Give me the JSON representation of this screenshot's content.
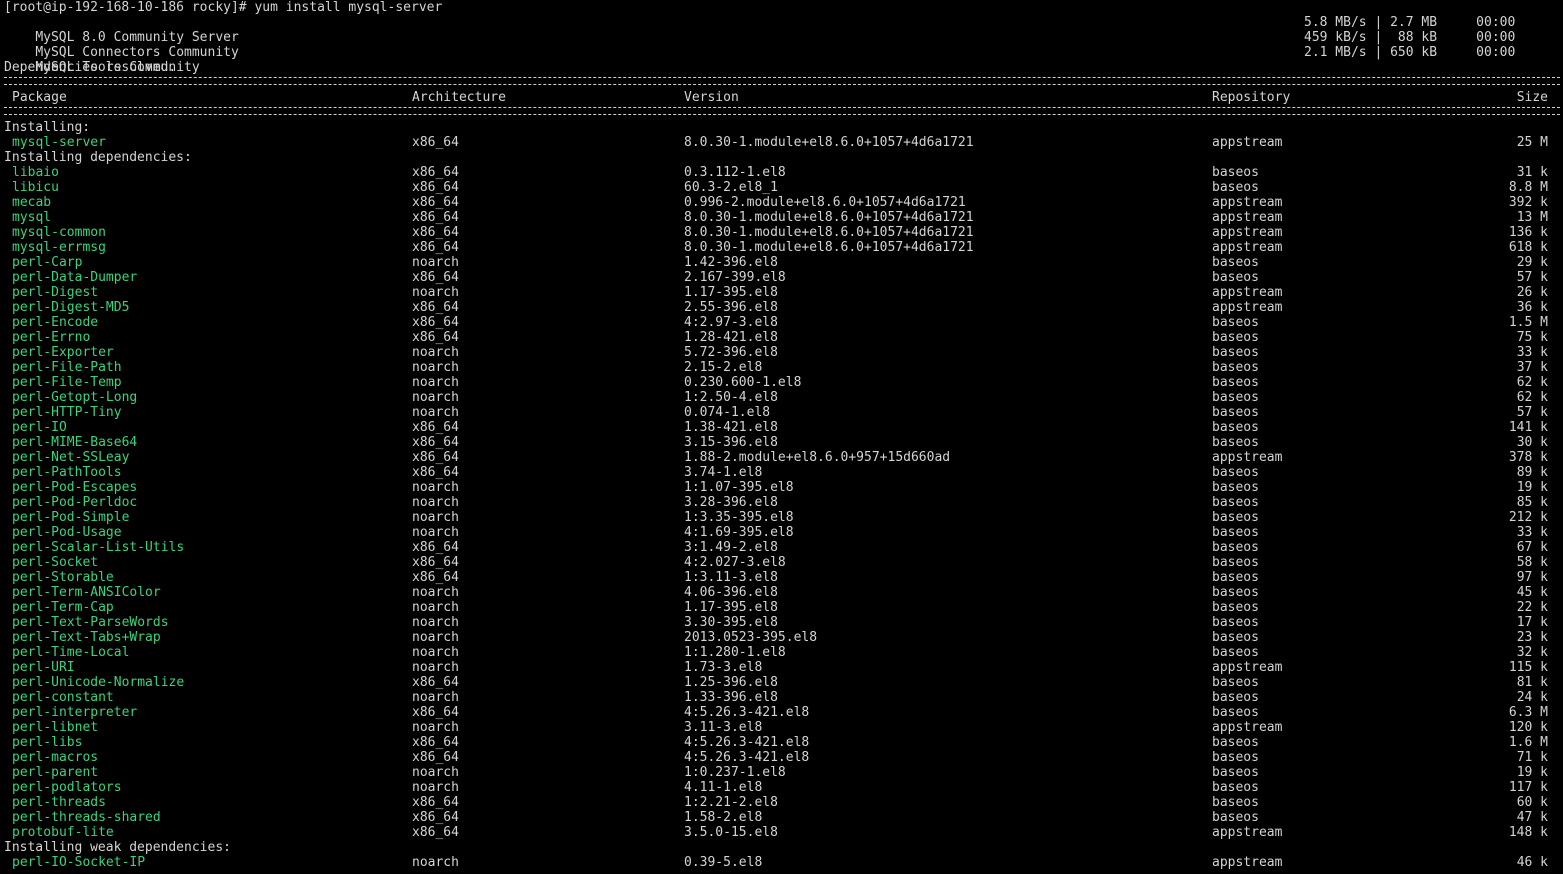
{
  "prompt_line": "[root@ip-192-168-10-186 rocky]# yum install mysql-server",
  "repo_downloads": [
    {
      "name": "MySQL 8.0 Community Server",
      "stats": "5.8 MB/s | 2.7 MB     00:00"
    },
    {
      "name": "MySQL Connectors Community",
      "stats": "459 kB/s |  88 kB     00:00"
    },
    {
      "name": "MySQL Tools Community",
      "stats": "2.1 MB/s | 650 kB     00:00"
    }
  ],
  "deps_resolved": "Dependencies resolved.",
  "headers": {
    "package": "Package",
    "arch": "Architecture",
    "version": "Version",
    "repo": "Repository",
    "size": "Size"
  },
  "sections": [
    {
      "title": "Installing:",
      "rows": [
        {
          "name": "mysql-server",
          "arch": "x86_64",
          "version": "8.0.30-1.module+el8.6.0+1057+4d6a1721",
          "repo": "appstream",
          "size": "25 M"
        }
      ]
    },
    {
      "title": "Installing dependencies:",
      "rows": [
        {
          "name": "libaio",
          "arch": "x86_64",
          "version": "0.3.112-1.el8",
          "repo": "baseos",
          "size": "31 k"
        },
        {
          "name": "libicu",
          "arch": "x86_64",
          "version": "60.3-2.el8_1",
          "repo": "baseos",
          "size": "8.8 M"
        },
        {
          "name": "mecab",
          "arch": "x86_64",
          "version": "0.996-2.module+el8.6.0+1057+4d6a1721",
          "repo": "appstream",
          "size": "392 k"
        },
        {
          "name": "mysql",
          "arch": "x86_64",
          "version": "8.0.30-1.module+el8.6.0+1057+4d6a1721",
          "repo": "appstream",
          "size": "13 M"
        },
        {
          "name": "mysql-common",
          "arch": "x86_64",
          "version": "8.0.30-1.module+el8.6.0+1057+4d6a1721",
          "repo": "appstream",
          "size": "136 k"
        },
        {
          "name": "mysql-errmsg",
          "arch": "x86_64",
          "version": "8.0.30-1.module+el8.6.0+1057+4d6a1721",
          "repo": "appstream",
          "size": "618 k"
        },
        {
          "name": "perl-Carp",
          "arch": "noarch",
          "version": "1.42-396.el8",
          "repo": "baseos",
          "size": "29 k"
        },
        {
          "name": "perl-Data-Dumper",
          "arch": "x86_64",
          "version": "2.167-399.el8",
          "repo": "baseos",
          "size": "57 k"
        },
        {
          "name": "perl-Digest",
          "arch": "noarch",
          "version": "1.17-395.el8",
          "repo": "appstream",
          "size": "26 k"
        },
        {
          "name": "perl-Digest-MD5",
          "arch": "x86_64",
          "version": "2.55-396.el8",
          "repo": "appstream",
          "size": "36 k"
        },
        {
          "name": "perl-Encode",
          "arch": "x86_64",
          "version": "4:2.97-3.el8",
          "repo": "baseos",
          "size": "1.5 M"
        },
        {
          "name": "perl-Errno",
          "arch": "x86_64",
          "version": "1.28-421.el8",
          "repo": "baseos",
          "size": "75 k"
        },
        {
          "name": "perl-Exporter",
          "arch": "noarch",
          "version": "5.72-396.el8",
          "repo": "baseos",
          "size": "33 k"
        },
        {
          "name": "perl-File-Path",
          "arch": "noarch",
          "version": "2.15-2.el8",
          "repo": "baseos",
          "size": "37 k"
        },
        {
          "name": "perl-File-Temp",
          "arch": "noarch",
          "version": "0.230.600-1.el8",
          "repo": "baseos",
          "size": "62 k"
        },
        {
          "name": "perl-Getopt-Long",
          "arch": "noarch",
          "version": "1:2.50-4.el8",
          "repo": "baseos",
          "size": "62 k"
        },
        {
          "name": "perl-HTTP-Tiny",
          "arch": "noarch",
          "version": "0.074-1.el8",
          "repo": "baseos",
          "size": "57 k"
        },
        {
          "name": "perl-IO",
          "arch": "x86_64",
          "version": "1.38-421.el8",
          "repo": "baseos",
          "size": "141 k"
        },
        {
          "name": "perl-MIME-Base64",
          "arch": "x86_64",
          "version": "3.15-396.el8",
          "repo": "baseos",
          "size": "30 k"
        },
        {
          "name": "perl-Net-SSLeay",
          "arch": "x86_64",
          "version": "1.88-2.module+el8.6.0+957+15d660ad",
          "repo": "appstream",
          "size": "378 k"
        },
        {
          "name": "perl-PathTools",
          "arch": "x86_64",
          "version": "3.74-1.el8",
          "repo": "baseos",
          "size": "89 k"
        },
        {
          "name": "perl-Pod-Escapes",
          "arch": "noarch",
          "version": "1:1.07-395.el8",
          "repo": "baseos",
          "size": "19 k"
        },
        {
          "name": "perl-Pod-Perldoc",
          "arch": "noarch",
          "version": "3.28-396.el8",
          "repo": "baseos",
          "size": "85 k"
        },
        {
          "name": "perl-Pod-Simple",
          "arch": "noarch",
          "version": "1:3.35-395.el8",
          "repo": "baseos",
          "size": "212 k"
        },
        {
          "name": "perl-Pod-Usage",
          "arch": "noarch",
          "version": "4:1.69-395.el8",
          "repo": "baseos",
          "size": "33 k"
        },
        {
          "name": "perl-Scalar-List-Utils",
          "arch": "x86_64",
          "version": "3:1.49-2.el8",
          "repo": "baseos",
          "size": "67 k"
        },
        {
          "name": "perl-Socket",
          "arch": "x86_64",
          "version": "4:2.027-3.el8",
          "repo": "baseos",
          "size": "58 k"
        },
        {
          "name": "perl-Storable",
          "arch": "x86_64",
          "version": "1:3.11-3.el8",
          "repo": "baseos",
          "size": "97 k"
        },
        {
          "name": "perl-Term-ANSIColor",
          "arch": "noarch",
          "version": "4.06-396.el8",
          "repo": "baseos",
          "size": "45 k"
        },
        {
          "name": "perl-Term-Cap",
          "arch": "noarch",
          "version": "1.17-395.el8",
          "repo": "baseos",
          "size": "22 k"
        },
        {
          "name": "perl-Text-ParseWords",
          "arch": "noarch",
          "version": "3.30-395.el8",
          "repo": "baseos",
          "size": "17 k"
        },
        {
          "name": "perl-Text-Tabs+Wrap",
          "arch": "noarch",
          "version": "2013.0523-395.el8",
          "repo": "baseos",
          "size": "23 k"
        },
        {
          "name": "perl-Time-Local",
          "arch": "noarch",
          "version": "1:1.280-1.el8",
          "repo": "baseos",
          "size": "32 k"
        },
        {
          "name": "perl-URI",
          "arch": "noarch",
          "version": "1.73-3.el8",
          "repo": "appstream",
          "size": "115 k"
        },
        {
          "name": "perl-Unicode-Normalize",
          "arch": "x86_64",
          "version": "1.25-396.el8",
          "repo": "baseos",
          "size": "81 k"
        },
        {
          "name": "perl-constant",
          "arch": "noarch",
          "version": "1.33-396.el8",
          "repo": "baseos",
          "size": "24 k"
        },
        {
          "name": "perl-interpreter",
          "arch": "x86_64",
          "version": "4:5.26.3-421.el8",
          "repo": "baseos",
          "size": "6.3 M"
        },
        {
          "name": "perl-libnet",
          "arch": "noarch",
          "version": "3.11-3.el8",
          "repo": "appstream",
          "size": "120 k"
        },
        {
          "name": "perl-libs",
          "arch": "x86_64",
          "version": "4:5.26.3-421.el8",
          "repo": "baseos",
          "size": "1.6 M"
        },
        {
          "name": "perl-macros",
          "arch": "x86_64",
          "version": "4:5.26.3-421.el8",
          "repo": "baseos",
          "size": "71 k"
        },
        {
          "name": "perl-parent",
          "arch": "noarch",
          "version": "1:0.237-1.el8",
          "repo": "baseos",
          "size": "19 k"
        },
        {
          "name": "perl-podlators",
          "arch": "noarch",
          "version": "4.11-1.el8",
          "repo": "baseos",
          "size": "117 k"
        },
        {
          "name": "perl-threads",
          "arch": "x86_64",
          "version": "1:2.21-2.el8",
          "repo": "baseos",
          "size": "60 k"
        },
        {
          "name": "perl-threads-shared",
          "arch": "x86_64",
          "version": "1.58-2.el8",
          "repo": "baseos",
          "size": "47 k"
        },
        {
          "name": "protobuf-lite",
          "arch": "x86_64",
          "version": "3.5.0-15.el8",
          "repo": "appstream",
          "size": "148 k"
        }
      ]
    },
    {
      "title": "Installing weak dependencies:",
      "rows": [
        {
          "name": "perl-IO-Socket-IP",
          "arch": "noarch",
          "version": "0.39-5.el8",
          "repo": "appstream",
          "size": "46 k"
        }
      ]
    }
  ],
  "colors": {
    "background": "#000000",
    "text": "#d4d4d4",
    "package_name": "#3ed17a"
  }
}
